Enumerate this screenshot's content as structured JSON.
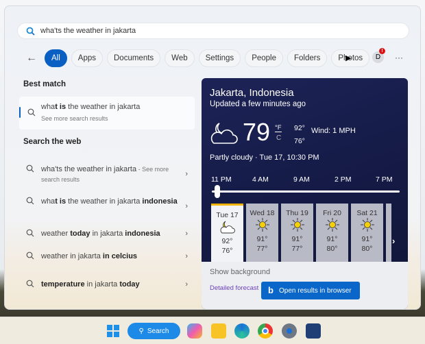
{
  "search": {
    "query": "wha'ts the weather in jakarta"
  },
  "tabs": [
    "All",
    "Apps",
    "Documents",
    "Web",
    "Settings",
    "People",
    "Folders",
    "Photos"
  ],
  "account_initial": "D",
  "more": "···",
  "best_match": {
    "label": "Best match",
    "title": [
      {
        "t": "wha",
        "b": false
      },
      {
        "t": "t is",
        "b": true
      },
      {
        "t": " the weather in jakarta",
        "b": false
      }
    ],
    "subtitle": "See more search results"
  },
  "web": {
    "label": "Search the web",
    "items": [
      {
        "segs": [
          {
            "t": "wha'ts the weather in jakarta",
            "b": false
          }
        ],
        "suffix": " - See more search results"
      },
      {
        "segs": [
          {
            "t": "wha",
            "b": false
          },
          {
            "t": "t is",
            "b": true
          },
          {
            "t": " the weather in jakarta ",
            "b": false
          },
          {
            "t": "indonesia",
            "b": true
          }
        ]
      },
      {
        "segs": [
          {
            "t": "weather ",
            "b": false
          },
          {
            "t": "today",
            "b": true
          },
          {
            "t": " in jakarta ",
            "b": false
          },
          {
            "t": "indonesia",
            "b": true
          }
        ]
      },
      {
        "segs": [
          {
            "t": "weather in jakarta ",
            "b": false
          },
          {
            "t": "in celcius",
            "b": true
          }
        ]
      },
      {
        "segs": [
          {
            "t": "temperature",
            "b": true
          },
          {
            "t": " in jakarta ",
            "b": false
          },
          {
            "t": "today",
            "b": true
          }
        ]
      }
    ]
  },
  "weather": {
    "location": "Jakarta, Indonesia",
    "updated": "Updated a few minutes ago",
    "temp": "79",
    "unit_f": "°F",
    "unit_c": "C",
    "high": "92°",
    "low": "76°",
    "wind": "Wind: 1 MPH",
    "condition": "Partly cloudy · Tue 17, 10:30 PM",
    "hours": [
      "11 PM",
      "4 AM",
      "9 AM",
      "2 PM",
      "7 PM"
    ],
    "slider_position": 0.03,
    "days": [
      {
        "name": "Tue 17",
        "hi": "92°",
        "lo": "76°",
        "icon": "partly-cloudy-night"
      },
      {
        "name": "Wed 18",
        "hi": "91°",
        "lo": "77°",
        "icon": "sun"
      },
      {
        "name": "Thu 19",
        "hi": "91°",
        "lo": "77°",
        "icon": "sun"
      },
      {
        "name": "Fri 20",
        "hi": "91°",
        "lo": "80°",
        "icon": "sun"
      },
      {
        "name": "Sat 21",
        "hi": "91°",
        "lo": "80°",
        "icon": "sun"
      }
    ],
    "show_background": "Show background",
    "detailed": "Detailed forecast",
    "open_browser": "Open results in browser"
  },
  "taskbar": {
    "search": "Search"
  }
}
